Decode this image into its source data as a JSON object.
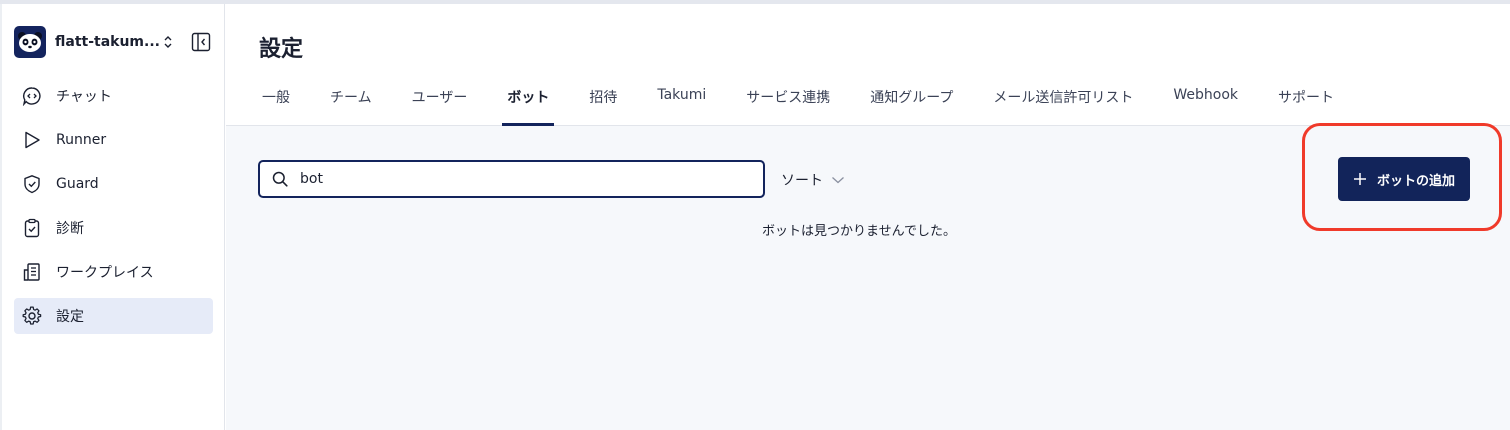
{
  "sidebar": {
    "workspace_name": "flatt-takum...",
    "items": [
      {
        "label": "チャット",
        "icon": "chat-icon",
        "active": false
      },
      {
        "label": "Runner",
        "icon": "play-icon",
        "active": false
      },
      {
        "label": "Guard",
        "icon": "shield-icon",
        "active": false
      },
      {
        "label": "診断",
        "icon": "clipboard-check-icon",
        "active": false
      },
      {
        "label": "ワークプレイス",
        "icon": "building-icon",
        "active": false
      },
      {
        "label": "設定",
        "icon": "gear-icon",
        "active": true
      }
    ]
  },
  "header": {
    "title": "設定",
    "tabs": [
      {
        "label": "一般"
      },
      {
        "label": "チーム"
      },
      {
        "label": "ユーザー"
      },
      {
        "label": "ボット",
        "active": true
      },
      {
        "label": "招待"
      },
      {
        "label": "Takumi"
      },
      {
        "label": "サービス連携"
      },
      {
        "label": "通知グループ"
      },
      {
        "label": "メール送信許可リスト"
      },
      {
        "label": "Webhook"
      },
      {
        "label": "サポート"
      }
    ]
  },
  "content": {
    "search_value": "bot",
    "sort_label": "ソート",
    "empty_message": "ボットは見つかりませんでした。",
    "add_button_label": "ボットの追加"
  },
  "colors": {
    "primary": "#12245a",
    "active_nav_bg": "#e6ebf8",
    "highlight": "#f03a2a",
    "content_bg": "#f6f8fb"
  }
}
